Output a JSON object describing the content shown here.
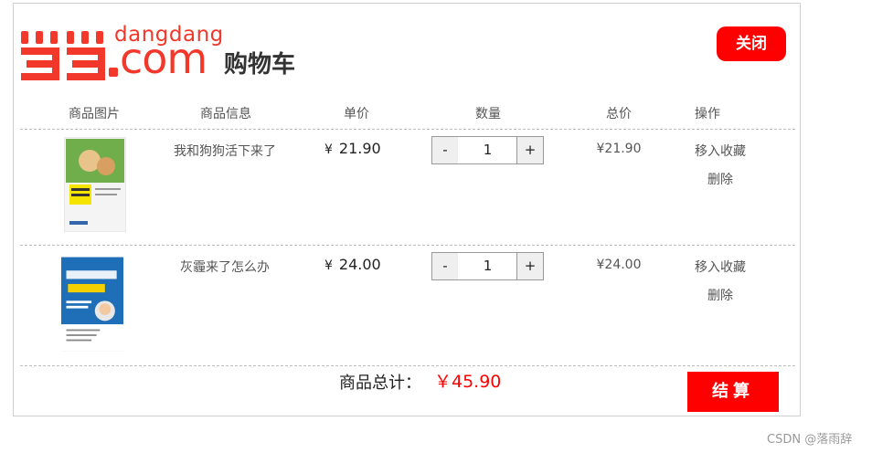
{
  "logo": {
    "small_text": "dangdang",
    "com_text": "com",
    "cart_text": "购物车",
    "brand_color": "#f2372b"
  },
  "close_label": "关闭",
  "headers": {
    "image": "商品图片",
    "info": "商品信息",
    "price": "单价",
    "qty": "数量",
    "total": "总价",
    "ops": "操作"
  },
  "items": [
    {
      "name": "我和狗狗活下来了",
      "currency": "¥",
      "price": "21.90",
      "qty": "1",
      "total": "¥21.90",
      "fav": "移入收藏",
      "del": "删除",
      "cover_color": "#6fae4a"
    },
    {
      "name": "灰霾来了怎么办",
      "currency": "¥",
      "price": "24.00",
      "qty": "1",
      "total": "¥24.00",
      "fav": "移入收藏",
      "del": "删除",
      "cover_color": "#1e6fb7"
    }
  ],
  "qty_minus": "-",
  "qty_plus": "+",
  "footer": {
    "sum_label": "商品总计：",
    "sum_value": "￥45.90",
    "checkout": "结算"
  },
  "watermark": "CSDN @落雨辞"
}
